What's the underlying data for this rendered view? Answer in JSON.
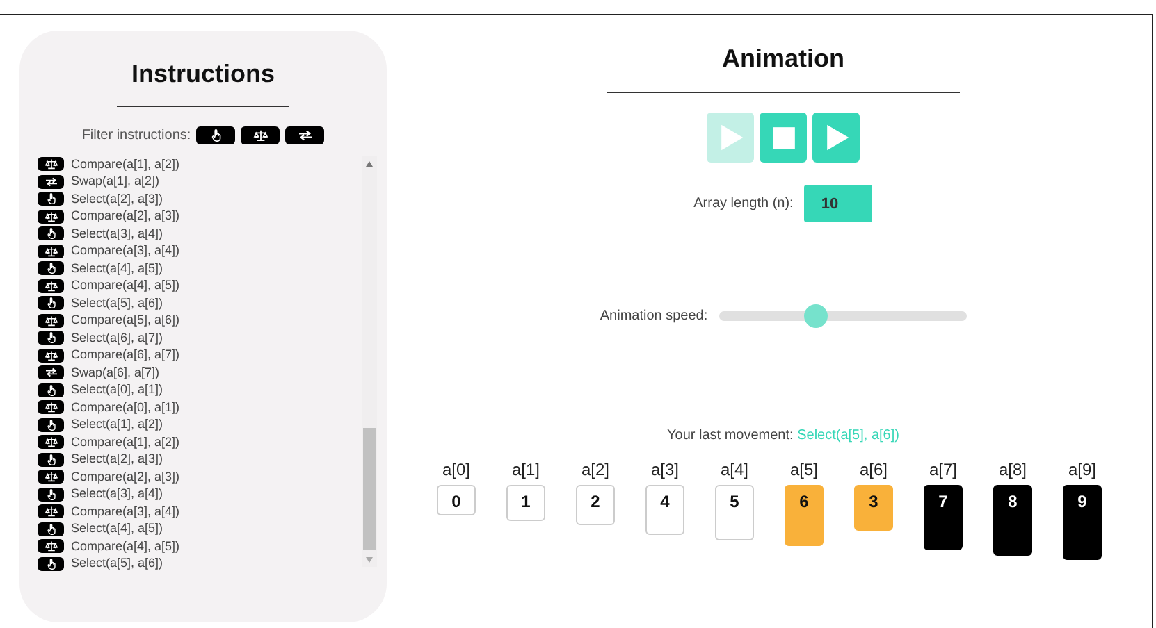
{
  "instructions": {
    "title": "Instructions",
    "filter_label": "Filter instructions:",
    "filters": [
      {
        "kind": "select"
      },
      {
        "kind": "compare"
      },
      {
        "kind": "swap"
      }
    ],
    "items": [
      {
        "kind": "compare",
        "text": "Compare(a[1], a[2])"
      },
      {
        "kind": "swap",
        "text": "Swap(a[1], a[2])"
      },
      {
        "kind": "select",
        "text": "Select(a[2], a[3])"
      },
      {
        "kind": "compare",
        "text": "Compare(a[2], a[3])"
      },
      {
        "kind": "select",
        "text": "Select(a[3], a[4])"
      },
      {
        "kind": "compare",
        "text": "Compare(a[3], a[4])"
      },
      {
        "kind": "select",
        "text": "Select(a[4], a[5])"
      },
      {
        "kind": "compare",
        "text": "Compare(a[4], a[5])"
      },
      {
        "kind": "select",
        "text": "Select(a[5], a[6])"
      },
      {
        "kind": "compare",
        "text": "Compare(a[5], a[6])"
      },
      {
        "kind": "select",
        "text": "Select(a[6], a[7])"
      },
      {
        "kind": "compare",
        "text": "Compare(a[6], a[7])"
      },
      {
        "kind": "swap",
        "text": "Swap(a[6], a[7])"
      },
      {
        "kind": "select",
        "text": "Select(a[0], a[1])"
      },
      {
        "kind": "compare",
        "text": "Compare(a[0], a[1])"
      },
      {
        "kind": "select",
        "text": "Select(a[1], a[2])"
      },
      {
        "kind": "compare",
        "text": "Compare(a[1], a[2])"
      },
      {
        "kind": "select",
        "text": "Select(a[2], a[3])"
      },
      {
        "kind": "compare",
        "text": "Compare(a[2], a[3])"
      },
      {
        "kind": "select",
        "text": "Select(a[3], a[4])"
      },
      {
        "kind": "compare",
        "text": "Compare(a[3], a[4])"
      },
      {
        "kind": "select",
        "text": "Select(a[4], a[5])"
      },
      {
        "kind": "compare",
        "text": "Compare(a[4], a[5])"
      },
      {
        "kind": "select",
        "text": "Select(a[5], a[6])"
      }
    ]
  },
  "animation": {
    "title": "Animation",
    "controls": [
      {
        "kind": "play",
        "disabled": true
      },
      {
        "kind": "stop",
        "disabled": false
      },
      {
        "kind": "play",
        "disabled": false
      }
    ],
    "array_length_label": "Array length (n):",
    "array_length": "10",
    "speed_label": "Animation speed:",
    "speed": {
      "level": 0.39
    },
    "last_movement_label": "Your last movement:",
    "last_movement": "Select(a[5], a[6])",
    "array": [
      {
        "label": "a[0]",
        "value": "0",
        "selected": false,
        "sorted": false
      },
      {
        "label": "a[1]",
        "value": "1",
        "selected": false,
        "sorted": false
      },
      {
        "label": "a[2]",
        "value": "2",
        "selected": false,
        "sorted": false
      },
      {
        "label": "a[3]",
        "value": "4",
        "selected": false,
        "sorted": false
      },
      {
        "label": "a[4]",
        "value": "5",
        "selected": false,
        "sorted": false
      },
      {
        "label": "a[5]",
        "value": "6",
        "selected": true,
        "sorted": false
      },
      {
        "label": "a[6]",
        "value": "3",
        "selected": true,
        "sorted": false
      },
      {
        "label": "a[7]",
        "value": "7",
        "selected": false,
        "sorted": true
      },
      {
        "label": "a[8]",
        "value": "8",
        "selected": false,
        "sorted": true
      },
      {
        "label": "a[9]",
        "value": "9",
        "selected": false,
        "sorted": true
      }
    ]
  }
}
